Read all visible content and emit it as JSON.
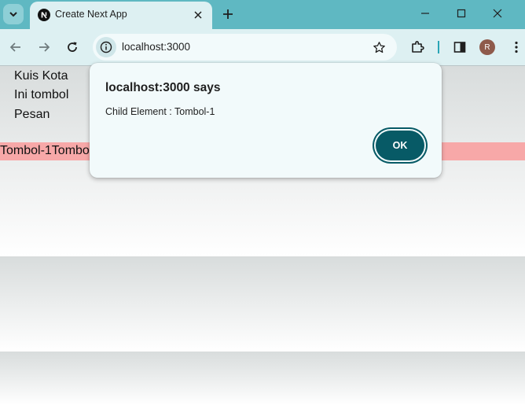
{
  "browser": {
    "tab": {
      "title": "Create Next App"
    },
    "new_tab_symbol": "+",
    "toolbar": {
      "url": "localhost:3000"
    },
    "profile": {
      "initial": "R"
    }
  },
  "page": {
    "lines": [
      "Kuis Kota",
      "Ini tombol",
      "Pesan"
    ],
    "button_row_text": "Tombol-1Tombol-2"
  },
  "dialog": {
    "title": "localhost:3000 says",
    "message": "Child Element : Tombol-1",
    "ok_label": "OK"
  },
  "colors": {
    "tab_strip": "#5fb8c2",
    "toolbar": "#ddf0f2",
    "dialog_button": "#075a66",
    "button_row_bg": "#f7a8a8"
  },
  "icons": [
    "tab-search-icon",
    "nextjs-favicon-icon",
    "close-icon",
    "new-tab-icon",
    "minimize-icon",
    "maximize-icon",
    "window-close-icon",
    "back-arrow-icon",
    "forward-arrow-icon",
    "reload-icon",
    "site-info-icon",
    "bookmark-star-icon",
    "extensions-icon",
    "side-panel-icon",
    "kebab-menu-icon"
  ]
}
